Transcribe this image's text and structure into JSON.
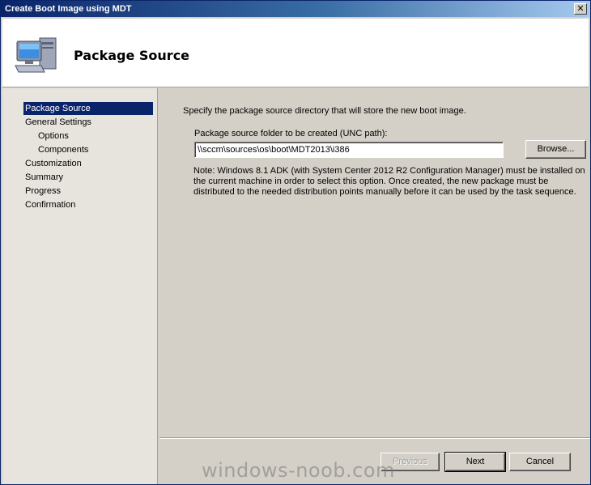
{
  "window": {
    "title": "Create Boot Image using MDT",
    "close_glyph": "✕"
  },
  "header": {
    "title": "Package Source",
    "icon": "computer-icon"
  },
  "nav": {
    "items": [
      {
        "label": "Package Source",
        "active": true,
        "sub": false
      },
      {
        "label": "General Settings",
        "active": false,
        "sub": false
      },
      {
        "label": "Options",
        "active": false,
        "sub": true
      },
      {
        "label": "Components",
        "active": false,
        "sub": true
      },
      {
        "label": "Customization",
        "active": false,
        "sub": false
      },
      {
        "label": "Summary",
        "active": false,
        "sub": false
      },
      {
        "label": "Progress",
        "active": false,
        "sub": false
      },
      {
        "label": "Confirmation",
        "active": false,
        "sub": false
      }
    ]
  },
  "content": {
    "instruction": "Specify the package source directory that will store the new boot image.",
    "field_label": "Package source folder to be created (UNC path):",
    "path_value": "\\\\sccm\\sources\\os\\boot\\MDT2013\\i386",
    "browse_label": "Browse...",
    "note": "Note: Windows 8.1 ADK (with System Center 2012 R2 Configuration Manager) must be installed on the current machine in order to select this option.  Once created, the new package must be distributed to the needed distribution points manually before it can be used by the task sequence."
  },
  "footer": {
    "previous_label": "Previous",
    "next_label": "Next",
    "cancel_label": "Cancel"
  },
  "watermark": "windows-noob.com",
  "colors": {
    "title_bar": "#0a246a",
    "selection": "#0a246a",
    "face": "#d4d0c8"
  }
}
